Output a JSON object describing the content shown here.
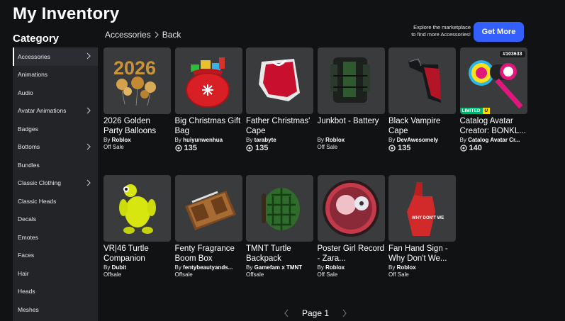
{
  "header": {
    "title": "My Inventory"
  },
  "sidebar": {
    "heading": "Category",
    "items": [
      {
        "label": "Accessories",
        "has_children": true,
        "active": true
      },
      {
        "label": "Animations",
        "has_children": false
      },
      {
        "label": "Audio",
        "has_children": false
      },
      {
        "label": "Avatar Animations",
        "has_children": true
      },
      {
        "label": "Badges",
        "has_children": false
      },
      {
        "label": "Bottoms",
        "has_children": true
      },
      {
        "label": "Bundles",
        "has_children": false
      },
      {
        "label": "Classic Clothing",
        "has_children": true
      },
      {
        "label": "Classic Heads",
        "has_children": false
      },
      {
        "label": "Decals",
        "has_children": false
      },
      {
        "label": "Emotes",
        "has_children": false
      },
      {
        "label": "Faces",
        "has_children": false
      },
      {
        "label": "Hair",
        "has_children": false
      },
      {
        "label": "Heads",
        "has_children": false
      },
      {
        "label": "Meshes",
        "has_children": false
      }
    ]
  },
  "breadcrumb": {
    "current": "Accessories",
    "back": "Back"
  },
  "promo": {
    "text_line1": "Explore the marketplace",
    "text_line2": "to find more Accessories!",
    "button": "Get More"
  },
  "items": [
    {
      "name": "2026 Golden Party Balloons",
      "by_prefix": "By",
      "creator": "Roblox",
      "price": "Off Sale",
      "price_type": "text"
    },
    {
      "name": "Big Christmas Gift Bag",
      "by_prefix": "By",
      "creator": "huiyunwenhua",
      "price": "135",
      "price_type": "robux"
    },
    {
      "name": "Father Christmas' Cape",
      "by_prefix": "By",
      "creator": "tarabyte",
      "price": "135",
      "price_type": "robux"
    },
    {
      "name": "Junkbot - Battery",
      "by_prefix": "By",
      "creator": "Roblox",
      "price": "Off Sale",
      "price_type": "text"
    },
    {
      "name": "Black Vampire Cape",
      "by_prefix": "By",
      "creator": "DevAwesomely",
      "price": "135",
      "price_type": "robux"
    },
    {
      "name": "Catalog Avatar Creator: BONKL...",
      "by_prefix": "By",
      "creator": "Catalog Avatar Cr...",
      "price": "140",
      "price_type": "robux",
      "serial": "#103633",
      "limited": "LIMITED",
      "limited_u": "U"
    },
    {
      "name": "VR|46 Turtle Companion",
      "by_prefix": "By",
      "creator": "Dubit",
      "price": "Offsale",
      "price_type": "text"
    },
    {
      "name": "Fenty Fragrance Boom Box",
      "by_prefix": "By",
      "creator": "fentybeautyands...",
      "price": "Offsale",
      "price_type": "text"
    },
    {
      "name": "TMNT Turtle Backpack",
      "by_prefix": "By",
      "creator": "Gamefam x TMNT",
      "price": "Offsale",
      "price_type": "text"
    },
    {
      "name": "Poster Girl Record - Zara...",
      "by_prefix": "By",
      "creator": "Roblox",
      "price": "Off Sale",
      "price_type": "text"
    },
    {
      "name": "Fan Hand Sign - Why Don't We...",
      "by_prefix": "By",
      "creator": "Roblox",
      "price": "Off Sale",
      "price_type": "text"
    }
  ],
  "first_card_extra": "--",
  "thumb_labels": {
    "balloons_text": "2026",
    "hand_text": "WHY DON'T WE"
  },
  "pagination": {
    "label": "Page 1"
  },
  "colors": {
    "accent": "#335fff",
    "background": "#111214",
    "sidebar": "#232428",
    "card": "#393b3d"
  }
}
